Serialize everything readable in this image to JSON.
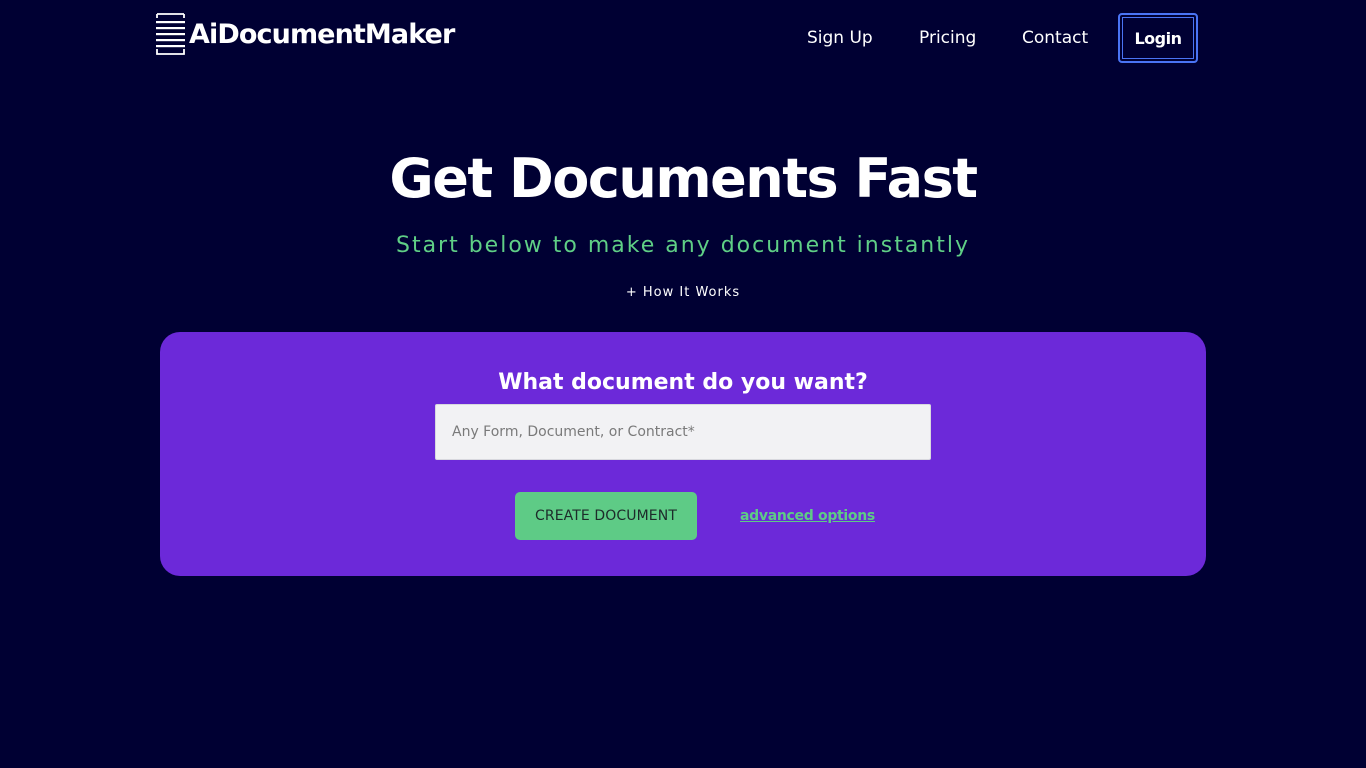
{
  "header": {
    "brand": "AiDocumentMaker",
    "logo_icon": "document-lines-icon",
    "nav": {
      "sign_up": "Sign Up",
      "pricing": "Pricing",
      "contact": "Contact",
      "login": "Login"
    }
  },
  "hero": {
    "title": "Get Documents Fast",
    "subtitle": "Start below to make any document instantly",
    "how_it_works_prefix": "+",
    "how_it_works": "How It Works"
  },
  "form": {
    "question": "What document do you want?",
    "input_placeholder": "Any Form, Document, or Contract*",
    "input_value": "",
    "create_button": "CREATE DOCUMENT",
    "advanced_options": "advanced options"
  },
  "colors": {
    "background": "#000033",
    "card": "#6c29d9",
    "accent_green": "#5ecb86",
    "login_border": "#4a74f5"
  }
}
